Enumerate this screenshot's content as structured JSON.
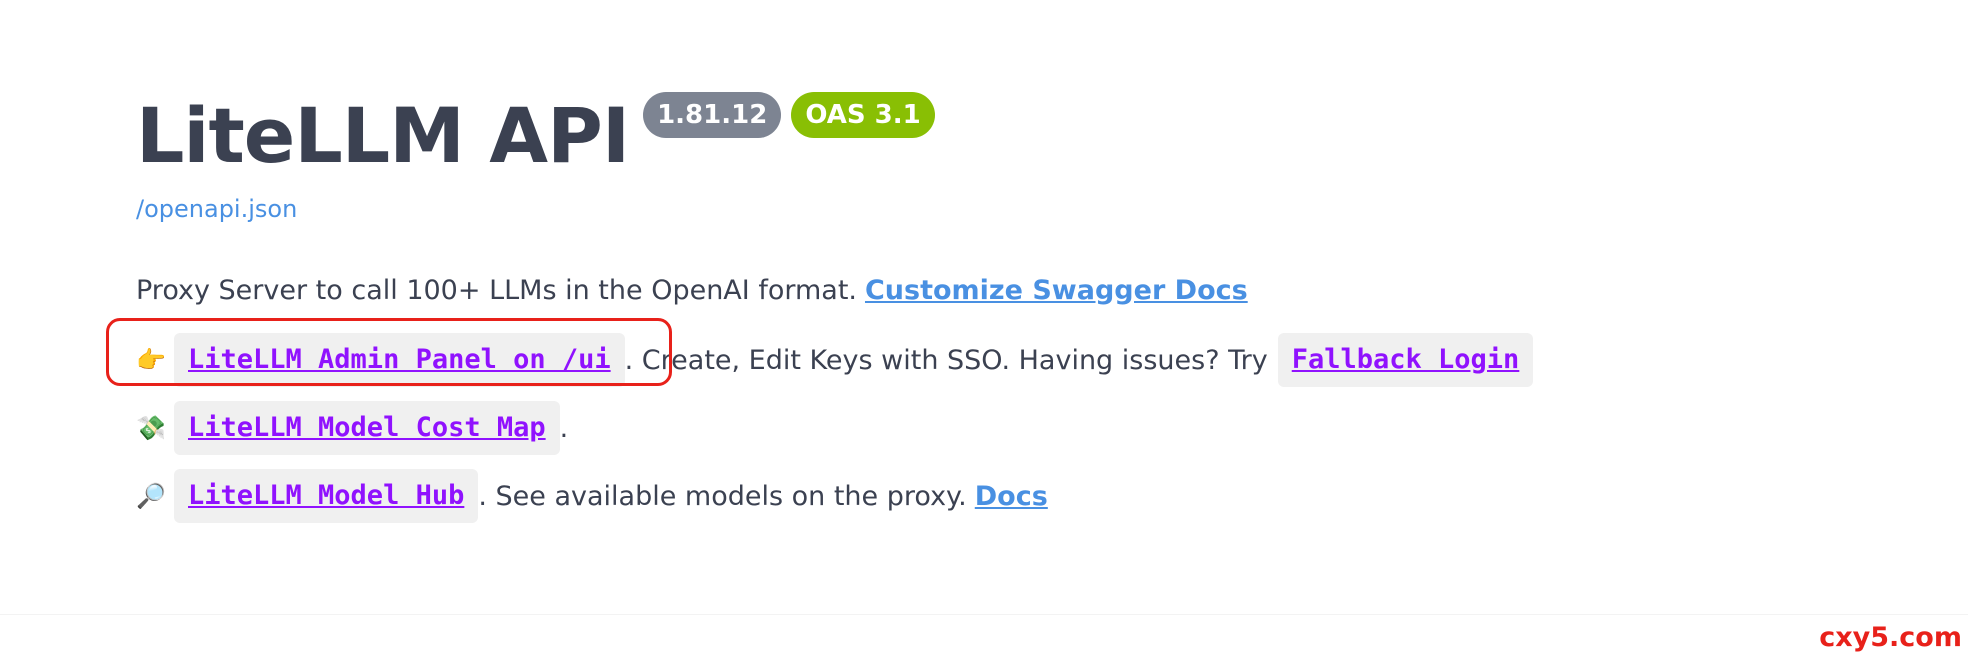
{
  "info": {
    "title": "LiteLLM API",
    "version_badge": "1.81.12",
    "oas_badge": "OAS 3.1",
    "spec_link": "/openapi.json"
  },
  "description": {
    "intro_text": "Proxy Server to call 100+ LLMs in the OpenAI format.",
    "customize_link": "Customize Swagger Docs",
    "admin_row": {
      "emoji": "👉",
      "link": "LiteLLM Admin Panel on /ui",
      "text": ". Create, Edit Keys with SSO. Having issues? Try",
      "fallback_link": "Fallback Login"
    },
    "cost_map_row": {
      "emoji": "💸",
      "link": "LiteLLM Model Cost Map",
      "text": "."
    },
    "model_hub_row": {
      "emoji": "🔎",
      "link": "LiteLLM Model Hub",
      "text": ". See available models on the proxy.",
      "docs_link": "Docs"
    }
  },
  "watermark": "cxy5.com",
  "colors": {
    "title": "#3b4151",
    "link": "#4990e2",
    "code_link": "#9012fe",
    "version_badge": "#7d8492",
    "oas_badge": "#89bf04",
    "highlight": "#e8211a"
  }
}
